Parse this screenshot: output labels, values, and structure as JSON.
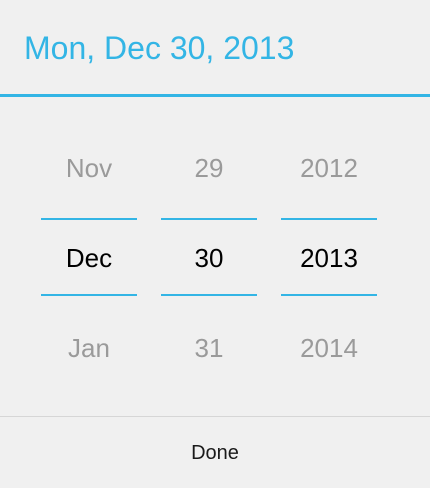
{
  "dialog": {
    "title": "Mon, Dec 30, 2013",
    "accent_color": "#33b5e5"
  },
  "pickers": {
    "month": {
      "prev": "Nov",
      "current": "Dec",
      "next": "Jan"
    },
    "day": {
      "prev": "29",
      "current": "30",
      "next": "31"
    },
    "year": {
      "prev": "2012",
      "current": "2013",
      "next": "2014"
    }
  },
  "buttons": {
    "done_label": "Done"
  }
}
